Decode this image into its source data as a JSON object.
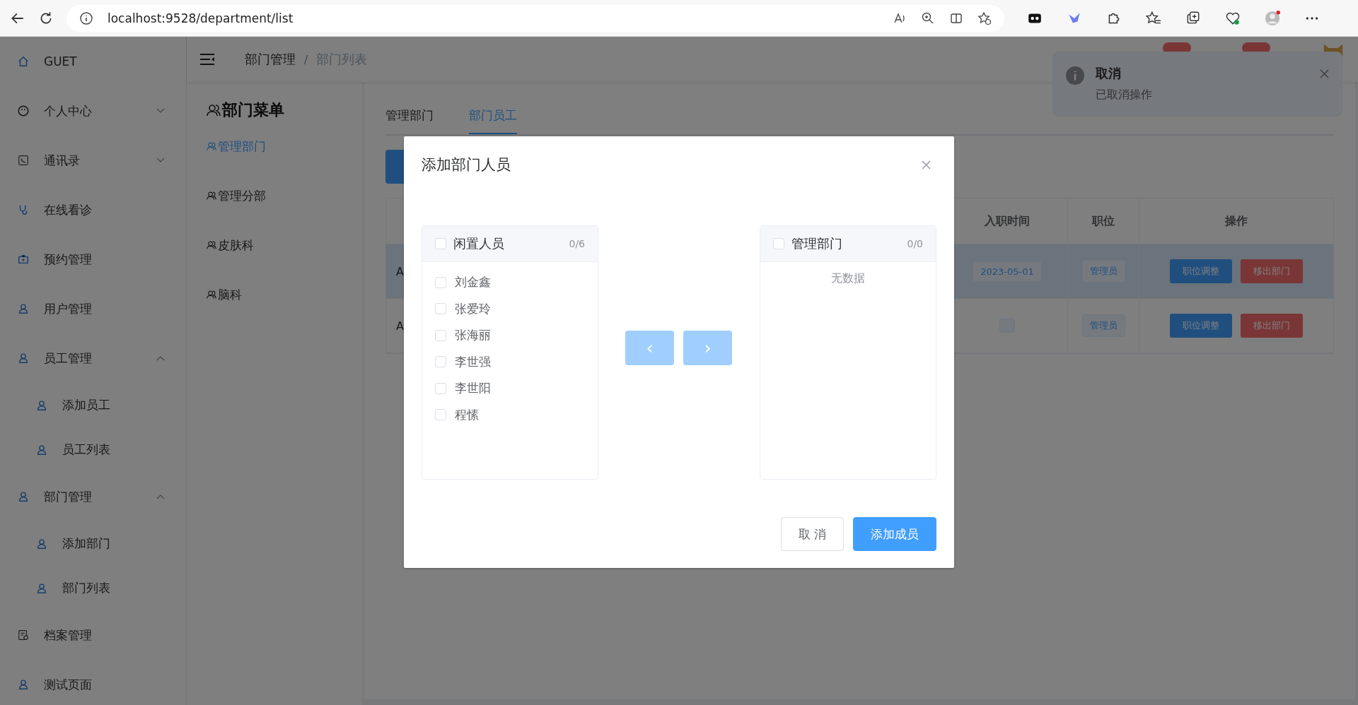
{
  "browser": {
    "url": "localhost:9528/department/list"
  },
  "sidebar": {
    "items": [
      {
        "label": "GUET"
      },
      {
        "label": "个人中心",
        "expanded": false
      },
      {
        "label": "通讯录",
        "expanded": false
      },
      {
        "label": "在线看诊"
      },
      {
        "label": "预约管理"
      },
      {
        "label": "用户管理"
      },
      {
        "label": "员工管理",
        "expanded": true,
        "children": [
          {
            "label": "添加员工"
          },
          {
            "label": "员工列表"
          }
        ]
      },
      {
        "label": "部门管理",
        "expanded": true,
        "children": [
          {
            "label": "添加部门"
          },
          {
            "label": "部门列表"
          }
        ]
      },
      {
        "label": "档案管理"
      },
      {
        "label": "测试页面"
      }
    ]
  },
  "breadcrumb": {
    "items": [
      "部门管理",
      "部门列表"
    ],
    "separator": "/"
  },
  "dept_menu": {
    "title": "部门菜单",
    "items": [
      {
        "label": "管理部门",
        "selected": true
      },
      {
        "label": "管理分部",
        "selected": false
      },
      {
        "label": "皮肤科",
        "selected": false
      },
      {
        "label": "脑科",
        "selected": false
      }
    ]
  },
  "tabs": [
    {
      "label": "管理部门",
      "selected": false
    },
    {
      "label": "部门员工",
      "selected": true
    }
  ],
  "table": {
    "columns": [
      "入职时间",
      "职位",
      "操作"
    ],
    "rows": [
      {
        "column_1": "A",
        "hired": "2023-05-01",
        "position": "管理员",
        "hovered": true,
        "actions": [
          "职位调整",
          "移出部门"
        ]
      },
      {
        "column_1": "A",
        "position": "管理员",
        "hovered": false,
        "actions": [
          "职位调整",
          "移出部门"
        ]
      }
    ]
  },
  "toast": {
    "title": "取消",
    "message": "已取消操作"
  },
  "dialog": {
    "title": "添加部门人员",
    "source": {
      "title": "闲置人员",
      "count": "0/6",
      "checked": false,
      "items": [
        {
          "label": "刘金鑫",
          "checked": false
        },
        {
          "label": "张爱玲",
          "checked": false
        },
        {
          "label": "张海丽",
          "checked": false
        },
        {
          "label": "李世强",
          "checked": false
        },
        {
          "label": "李世阳",
          "checked": false
        },
        {
          "label": "程愫",
          "checked": false
        }
      ]
    },
    "target": {
      "title": "管理部门",
      "count": "0/0",
      "checked": false,
      "empty_text": "无数据"
    },
    "move_left": {
      "label": "‹",
      "disabled": true
    },
    "move_right": {
      "label": "›",
      "disabled": true
    },
    "buttons": [
      {
        "label": "取 消",
        "kind": "plain"
      },
      {
        "label": "添加成员",
        "kind": "primary"
      }
    ]
  }
}
